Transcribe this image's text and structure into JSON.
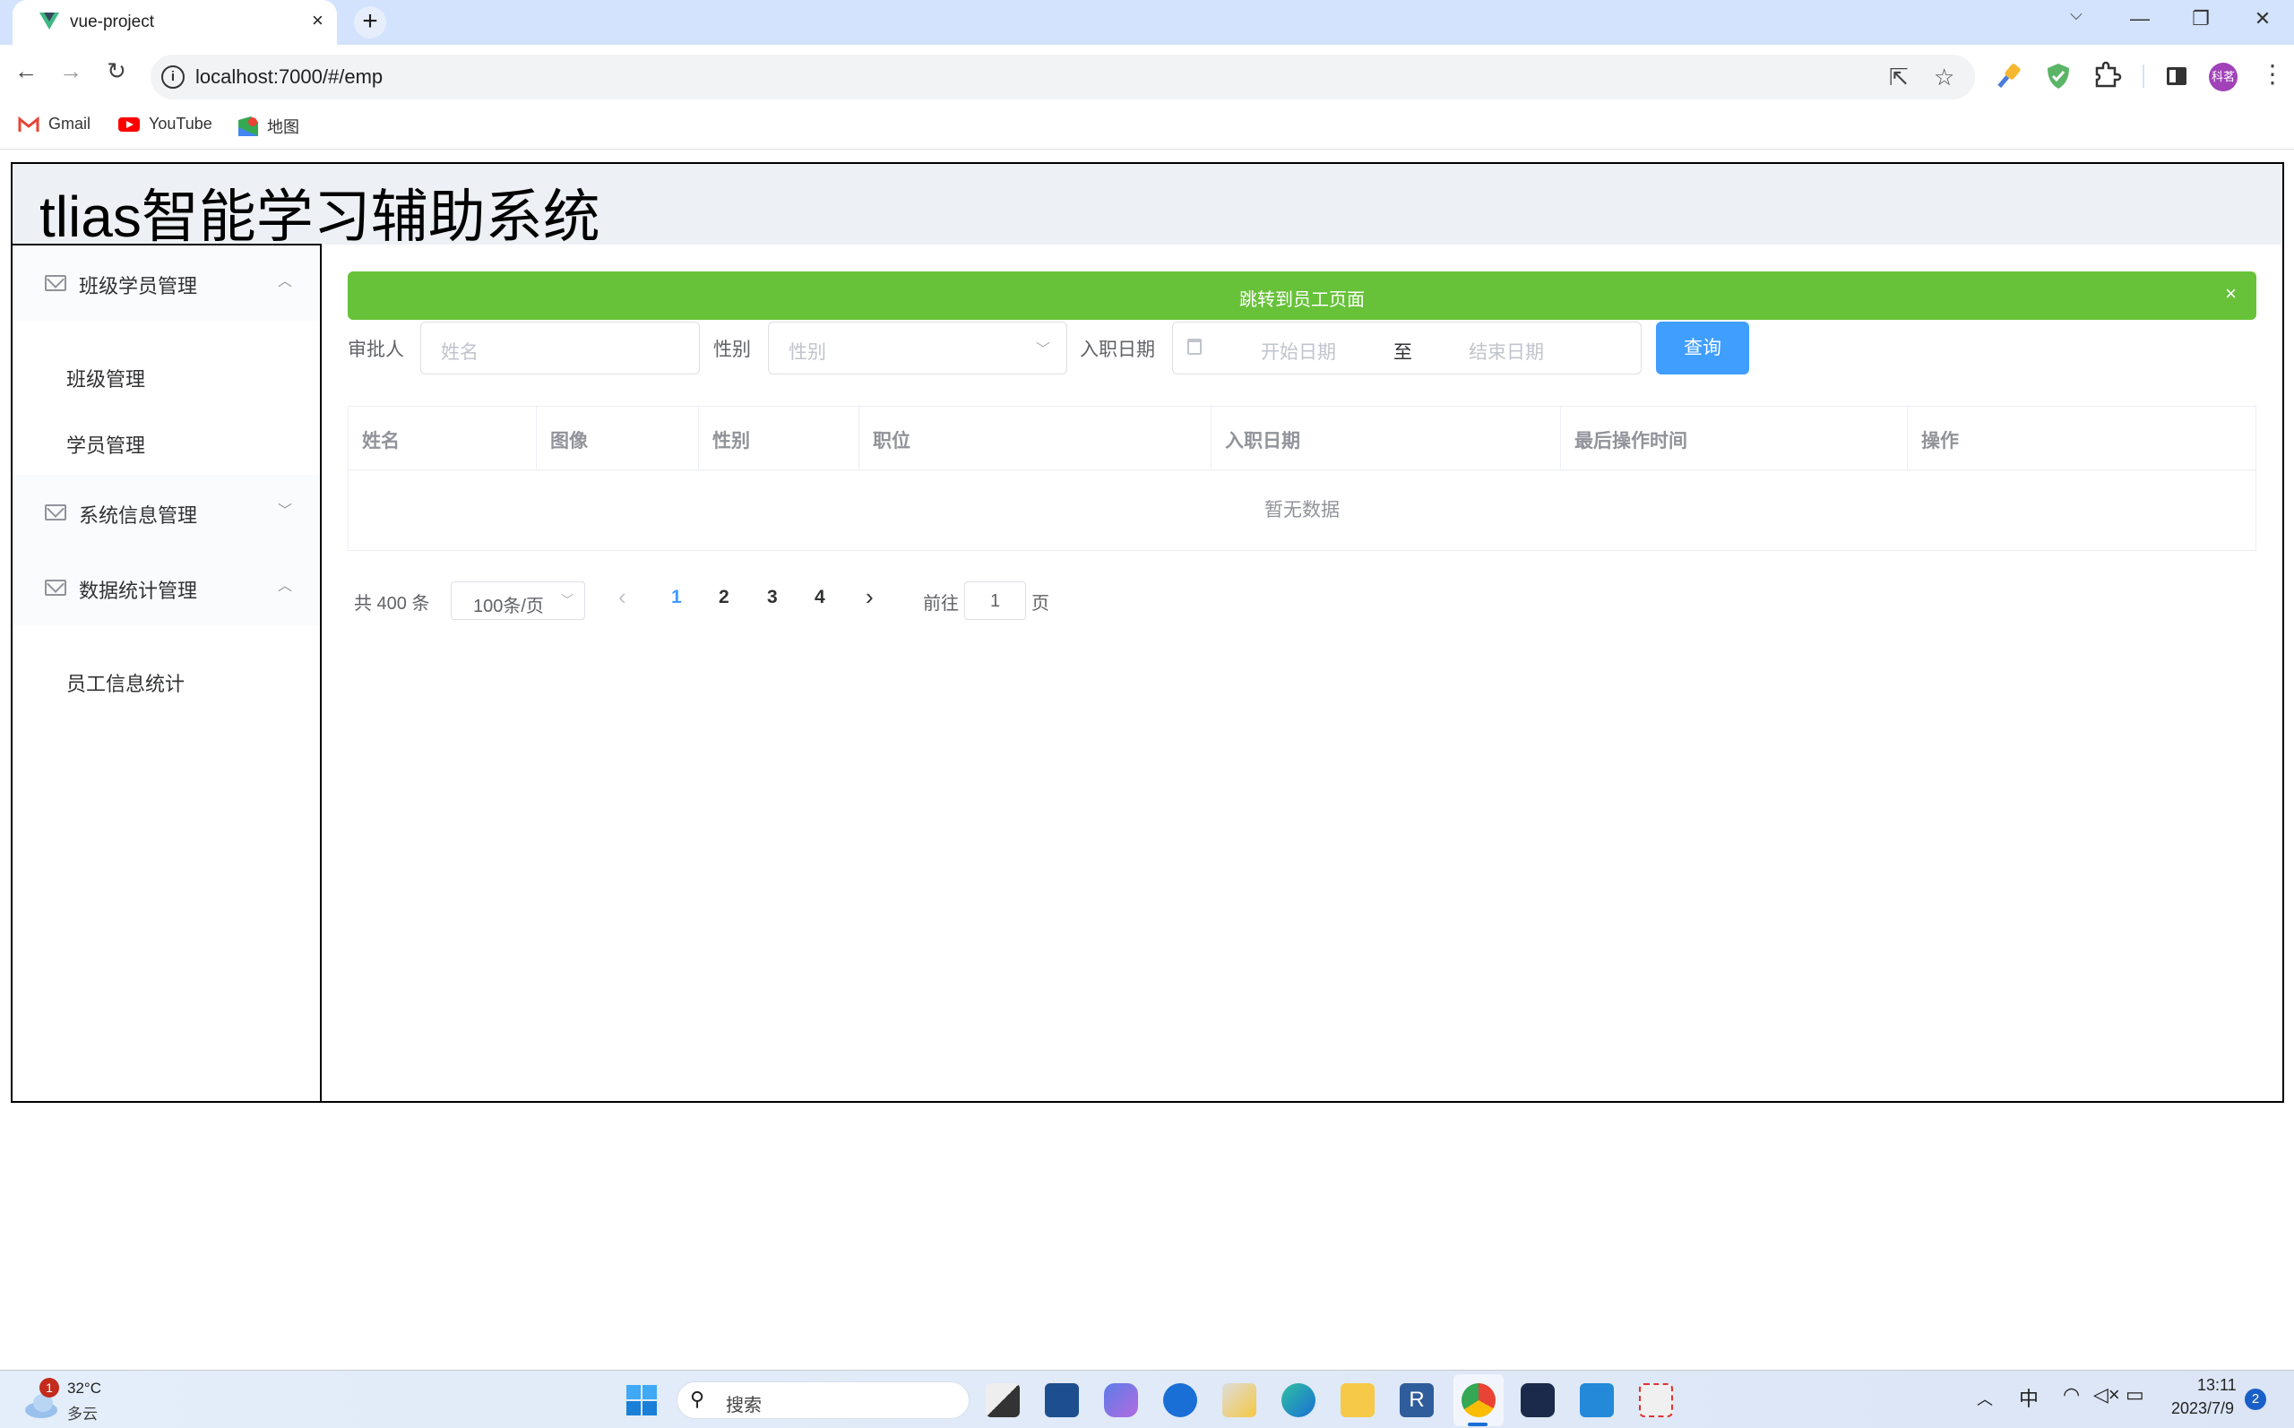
{
  "browser": {
    "tab_title": "vue-project",
    "tab_close": "×",
    "new_tab": "+",
    "window_controls": {
      "dropdown": "⌵",
      "minimize": "—",
      "restore": "❐",
      "close": "✕"
    },
    "nav": {
      "back": "←",
      "forward": "→",
      "reload": "↻"
    },
    "url": "localhost:7000/#/emp",
    "info_icon": "i",
    "share_icon": "⇱",
    "star_icon": "☆",
    "profile_initials": "科茗",
    "menu_icon": "⋮",
    "bookmarks": [
      {
        "label": "Gmail",
        "icon": "gmail-icon"
      },
      {
        "label": "YouTube",
        "icon": "youtube-icon"
      },
      {
        "label": "地图",
        "icon": "maps-icon"
      }
    ]
  },
  "app": {
    "title": "tlias智能学习辅助系统",
    "sidebar": {
      "groups": [
        {
          "label": "班级学员管理",
          "chevron": "︿",
          "expanded": true,
          "items": [
            "班级管理",
            "学员管理"
          ]
        },
        {
          "label": "系统信息管理",
          "chevron": "﹀",
          "expanded": false,
          "items": []
        },
        {
          "label": "数据统计管理",
          "chevron": "︿",
          "expanded": true,
          "items": [
            "员工信息统计"
          ]
        }
      ]
    },
    "alert": {
      "message": "跳转到员工页面",
      "close": "×",
      "color": "#67c23a"
    },
    "filters": {
      "approver_label": "审批人",
      "approver_placeholder": "姓名",
      "gender_label": "性别",
      "gender_placeholder": "性别",
      "date_label": "入职日期",
      "start_placeholder": "开始日期",
      "range_separator": "至",
      "end_placeholder": "结束日期",
      "query_button": "查询",
      "chevron": "﹀"
    },
    "table": {
      "columns": [
        "姓名",
        "图像",
        "性别",
        "职位",
        "入职日期",
        "最后操作时间",
        "操作"
      ],
      "rows": [],
      "empty_text": "暂无数据"
    },
    "pagination": {
      "total_text": "共 400 条",
      "page_size": "100条/页",
      "prev": "‹",
      "next": "›",
      "pages": [
        "1",
        "2",
        "3",
        "4"
      ],
      "current_page": "1",
      "goto_label": "前往",
      "goto_value": "1",
      "goto_suffix": "页",
      "accent": "#409eff"
    }
  },
  "taskbar": {
    "weather_temp": "32°C",
    "weather_desc": "多云",
    "weather_badge": "1",
    "search_placeholder": "搜索",
    "tray": {
      "chevron": "︿",
      "ime": "中",
      "time": "13:11",
      "date": "2023/7/9",
      "notification_count": "2"
    }
  }
}
